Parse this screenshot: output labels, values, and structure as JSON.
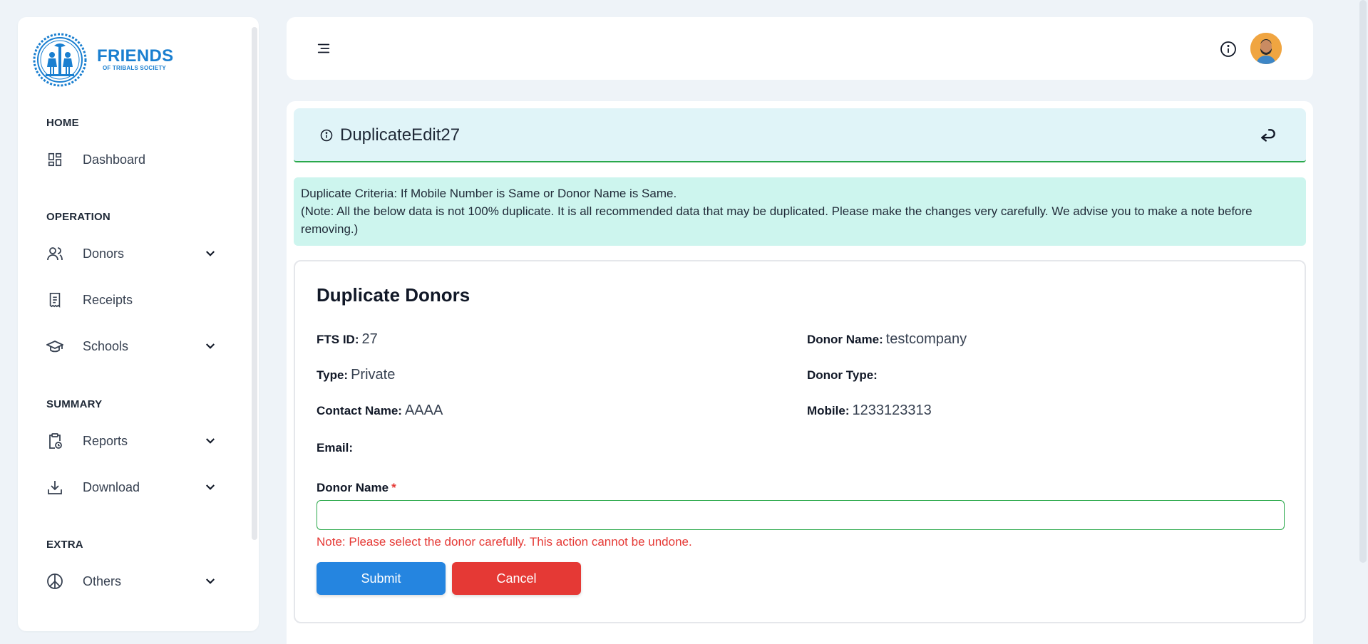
{
  "brand": {
    "name": "FRIENDS",
    "subtitle": "OF TRIBALS SOCIETY",
    "color": "#1a7fd0"
  },
  "sidebar": {
    "sections": {
      "home": "HOME",
      "operation": "OPERATION",
      "summary": "SUMMARY",
      "extra": "EXTRA"
    },
    "items": {
      "dashboard": {
        "label": "Dashboard",
        "icon": "dashboard-icon"
      },
      "donors": {
        "label": "Donors",
        "icon": "users-icon"
      },
      "receipts": {
        "label": "Receipts",
        "icon": "receipt-icon"
      },
      "schools": {
        "label": "Schools",
        "icon": "graduation-cap-icon"
      },
      "reports": {
        "label": "Reports",
        "icon": "clipboard-icon"
      },
      "download": {
        "label": "Download",
        "icon": "download-icon"
      },
      "others": {
        "label": "Others",
        "icon": "peace-icon"
      }
    }
  },
  "topbar": {
    "menu_icon": "menu-icon",
    "info_icon": "info-icon",
    "avatar": "user-avatar"
  },
  "page": {
    "title": "DuplicateEdit27",
    "back_icon": "return-icon",
    "criteria_line1": "Duplicate Criteria: If Mobile Number is Same or Donor Name is Same.",
    "criteria_line2": "(Note: All the below data is not 100% duplicate. It is all recommended data that may be duplicated. Please make the changes very carefully. We advise you to make a note before removing.)"
  },
  "duplicate": {
    "title": "Duplicate Donors",
    "fields": {
      "fts_id": {
        "label": "FTS ID:",
        "value": "27"
      },
      "donor_name": {
        "label": "Donor Name:",
        "value": "testcompany"
      },
      "type": {
        "label": "Type:",
        "value": "Private"
      },
      "donor_type": {
        "label": "Donor Type:",
        "value": ""
      },
      "contact_name": {
        "label": "Contact Name:",
        "value": "AAAA"
      },
      "mobile": {
        "label": "Mobile:",
        "value": "1233123313"
      },
      "email": {
        "label": "Email:",
        "value": ""
      }
    },
    "form": {
      "donor_name_label": "Donor Name",
      "required_mark": "*",
      "donor_name_value": "",
      "note": "Note: Please select the donor carefully. This action cannot be undone.",
      "submit_label": "Submit",
      "cancel_label": "Cancel"
    }
  },
  "colors": {
    "primary": "#2585e0",
    "danger": "#e53935",
    "success": "#2aa84a",
    "header_bg": "#e0f4f8",
    "criteria_bg": "#cdf5ee"
  }
}
